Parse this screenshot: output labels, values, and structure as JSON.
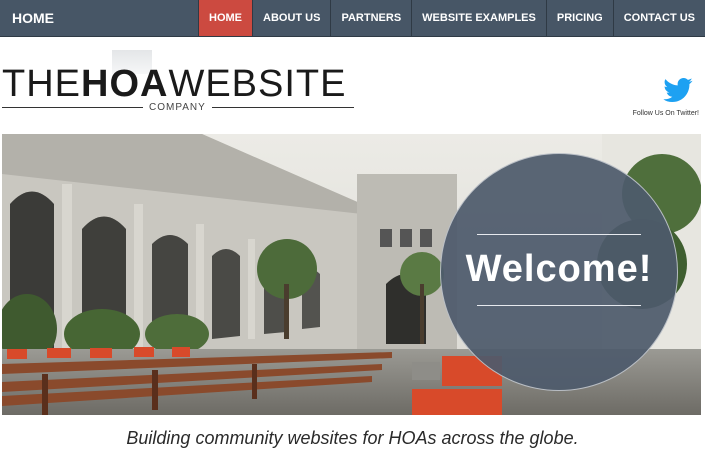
{
  "nav": {
    "brand": "HOME",
    "items": [
      {
        "label": "HOME",
        "active": true
      },
      {
        "label": "ABOUT US",
        "active": false
      },
      {
        "label": "PARTNERS",
        "active": false
      },
      {
        "label": "WEBSITE EXAMPLES",
        "active": false
      },
      {
        "label": "PRICING",
        "active": false
      },
      {
        "label": "CONTACT US",
        "active": false
      }
    ]
  },
  "logo": {
    "part1": "THE",
    "part2": "HOA",
    "part3": "WEBSITE",
    "subtitle": "COMPANY"
  },
  "twitter": {
    "icon": "twitter-bird-icon",
    "label": "Follow Us On Twitter!"
  },
  "hero": {
    "welcome": "Welcome!"
  },
  "tagline": "Building community websites for HOAs across the globe.",
  "colors": {
    "nav_bg": "#475666",
    "nav_active": "#cc4a40",
    "twitter_blue": "#1da1f2",
    "welcome_circle": "#4e5a6c"
  }
}
